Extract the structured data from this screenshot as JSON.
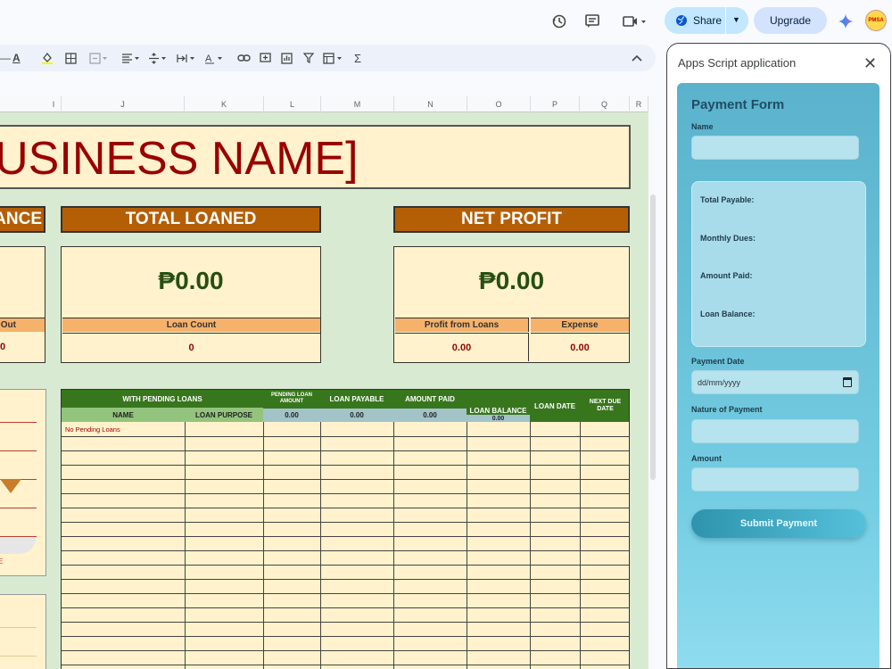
{
  "topbar": {
    "share_label": "Share",
    "upgrade_label": "Upgrade",
    "avatar_text": "PMSA"
  },
  "columns": [
    "I",
    "J",
    "K",
    "L",
    "M",
    "N",
    "O",
    "P",
    "Q",
    "R"
  ],
  "sheet": {
    "business_name": "[BUSINESS NAME]",
    "partial_header": "BALANCE",
    "total_loaned_label": "TOTAL LOANED",
    "net_profit_label": "NET PROFIT",
    "total_loaned_value": "₱0.00",
    "net_profit_value": "₱0.00",
    "partial_sub_label": "Out",
    "partial_sub_value": "0",
    "loan_count_label": "Loan Count",
    "loan_count_value": "0",
    "profit_from_loans_label": "Profit from Loans",
    "profit_from_loans_value": "0.00",
    "expense_label": "Expense",
    "expense_value": "0.00",
    "partial_panel_text": "E"
  },
  "loans_table": {
    "group_header": "WITH PENDING LOANS",
    "col_pending": "PENDING LOAN AMOUNT",
    "col_payable": "LOAN PAYABLE",
    "col_paid": "AMOUNT PAID",
    "col_balance": "LOAN BALANCE",
    "col_date": "LOAN DATE",
    "col_next": "NEXT DUE DATE",
    "col_name": "NAME",
    "col_purpose": "LOAN PURPOSE",
    "total_pending": "0.00",
    "total_payable": "0.00",
    "total_paid": "0.00",
    "total_balance": "0.00",
    "empty_message": "No Pending Loans"
  },
  "side_panel": {
    "title": "Apps Script application",
    "form_title": "Payment Form",
    "name_label": "Name",
    "total_payable_label": "Total Payable:",
    "monthly_dues_label": "Monthly Dues:",
    "amount_paid_label": "Amount Paid:",
    "loan_balance_label": "Loan Balance:",
    "payment_date_label": "Payment Date",
    "date_placeholder": "dd/mm/yyyy",
    "nature_label": "Nature of Payment",
    "amount_label": "Amount",
    "submit_label": "Submit Payment"
  },
  "colors": {
    "sheet_bg": "#d9ead3",
    "header_orange": "#b45f06",
    "cell_cream": "#fff2cc",
    "money_green": "#274e13",
    "table_green": "#38761d",
    "business_red": "#990000"
  }
}
